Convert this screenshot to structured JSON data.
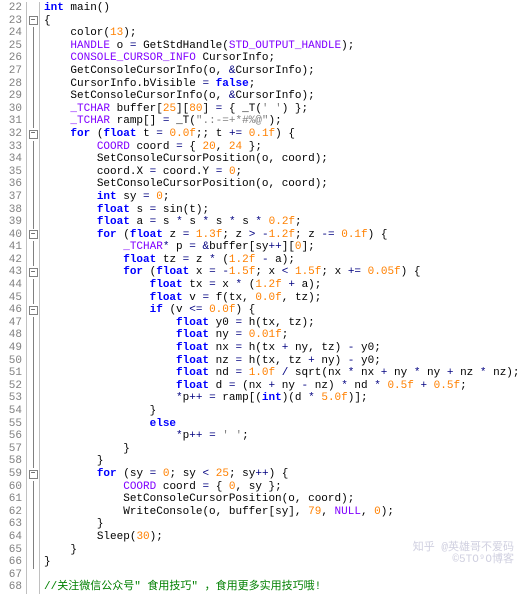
{
  "gutter_start": 22,
  "lines": [
    {
      "n": 22,
      "fold": "",
      "html": "<span class='kw'>int</span> <span class='fn'>main</span><span class='p'>()</span>"
    },
    {
      "n": 23,
      "fold": "box",
      "html": "<span class='p'>{</span>"
    },
    {
      "n": 24,
      "fold": "line",
      "html": "    <span class='fn'>color</span><span class='p'>(</span><span class='num'>13</span><span class='p'>);</span>"
    },
    {
      "n": 25,
      "fold": "line",
      "html": "    <span class='ty'>HANDLE</span> <span class='id'>o</span> <span class='op'>=</span> <span class='fn'>GetStdHandle</span><span class='p'>(</span><span class='mac'>STD_OUTPUT_HANDLE</span><span class='p'>);</span>"
    },
    {
      "n": 26,
      "fold": "line",
      "html": "    <span class='ty'>CONSOLE_CURSOR_INFO</span> <span class='id'>CursorInfo</span><span class='p'>;</span>"
    },
    {
      "n": 27,
      "fold": "line",
      "html": "    <span class='fn'>GetConsoleCursorInfo</span><span class='p'>(</span><span class='id'>o</span><span class='p'>,</span> <span class='op'>&amp;</span><span class='id'>CursorInfo</span><span class='p'>);</span>"
    },
    {
      "n": 28,
      "fold": "line",
      "html": "    <span class='id'>CursorInfo</span><span class='p'>.</span><span class='id'>bVisible</span> <span class='op'>=</span> <span class='kw'>false</span><span class='p'>;</span>"
    },
    {
      "n": 29,
      "fold": "line",
      "html": "    <span class='fn'>SetConsoleCursorInfo</span><span class='p'>(</span><span class='id'>o</span><span class='p'>,</span> <span class='op'>&amp;</span><span class='id'>CursorInfo</span><span class='p'>);</span>"
    },
    {
      "n": 30,
      "fold": "line",
      "html": "    <span class='ty'>_TCHAR</span> <span class='id'>buffer</span><span class='p'>[</span><span class='num'>25</span><span class='p'>][</span><span class='num'>80</span><span class='p'>]</span> <span class='op'>=</span> <span class='p'>{</span> <span class='fn'>_T</span><span class='p'>(</span><span class='str'>' '</span><span class='p'>) };</span>"
    },
    {
      "n": 31,
      "fold": "line",
      "html": "    <span class='ty'>_TCHAR</span> <span class='id'>ramp</span><span class='p'>[]</span> <span class='op'>=</span> <span class='fn'>_T</span><span class='p'>(</span><span class='str'>\".:-=+*#%@\"</span><span class='p'>);</span>"
    },
    {
      "n": 32,
      "fold": "box",
      "html": "    <span class='kw'>for</span> <span class='p'>(</span><span class='kw'>float</span> <span class='id'>t</span> <span class='op'>=</span> <span class='num'>0.0f</span><span class='p'>;;</span> <span class='id'>t</span> <span class='op'>+=</span> <span class='num'>0.1f</span><span class='p'>) {</span>"
    },
    {
      "n": 33,
      "fold": "line",
      "html": "        <span class='ty'>COORD</span> <span class='id'>coord</span> <span class='op'>=</span> <span class='p'>{</span> <span class='num'>20</span><span class='p'>,</span> <span class='num'>24</span> <span class='p'>};</span>"
    },
    {
      "n": 34,
      "fold": "line",
      "html": "        <span class='fn'>SetConsoleCursorPosition</span><span class='p'>(</span><span class='id'>o</span><span class='p'>,</span> <span class='id'>coord</span><span class='p'>);</span>"
    },
    {
      "n": 35,
      "fold": "line",
      "html": "        <span class='id'>coord</span><span class='p'>.</span><span class='id'>X</span> <span class='op'>=</span> <span class='id'>coord</span><span class='p'>.</span><span class='id'>Y</span> <span class='op'>=</span> <span class='num'>0</span><span class='p'>;</span>"
    },
    {
      "n": 36,
      "fold": "line",
      "html": "        <span class='fn'>SetConsoleCursorPosition</span><span class='p'>(</span><span class='id'>o</span><span class='p'>,</span> <span class='id'>coord</span><span class='p'>);</span>"
    },
    {
      "n": 37,
      "fold": "line",
      "html": "        <span class='kw'>int</span> <span class='id'>sy</span> <span class='op'>=</span> <span class='num'>0</span><span class='p'>;</span>"
    },
    {
      "n": 38,
      "fold": "line",
      "html": "        <span class='kw'>float</span> <span class='id'>s</span> <span class='op'>=</span> <span class='fn'>sin</span><span class='p'>(</span><span class='id'>t</span><span class='p'>);</span>"
    },
    {
      "n": 39,
      "fold": "line",
      "html": "        <span class='kw'>float</span> <span class='id'>a</span> <span class='op'>=</span> <span class='id'>s</span> <span class='op'>*</span> <span class='id'>s</span> <span class='op'>*</span> <span class='id'>s</span> <span class='op'>*</span> <span class='id'>s</span> <span class='op'>*</span> <span class='num'>0.2f</span><span class='p'>;</span>"
    },
    {
      "n": 40,
      "fold": "box",
      "html": "        <span class='kw'>for</span> <span class='p'>(</span><span class='kw'>float</span> <span class='id'>z</span> <span class='op'>=</span> <span class='num'>1.3f</span><span class='p'>;</span> <span class='id'>z</span> <span class='op'>&gt;</span> <span class='op'>-</span><span class='num'>1.2f</span><span class='p'>;</span> <span class='id'>z</span> <span class='op'>-=</span> <span class='num'>0.1f</span><span class='p'>) {</span>"
    },
    {
      "n": 41,
      "fold": "line",
      "html": "            <span class='ty'>_TCHAR</span><span class='op'>*</span> <span class='id'>p</span> <span class='op'>=</span> <span class='op'>&amp;</span><span class='id'>buffer</span><span class='p'>[</span><span class='id'>sy</span><span class='op'>++</span><span class='p'>][</span><span class='num'>0</span><span class='p'>];</span>"
    },
    {
      "n": 42,
      "fold": "line",
      "html": "            <span class='kw'>float</span> <span class='id'>tz</span> <span class='op'>=</span> <span class='id'>z</span> <span class='op'>*</span> <span class='p'>(</span><span class='num'>1.2f</span> <span class='op'>-</span> <span class='id'>a</span><span class='p'>);</span>"
    },
    {
      "n": 43,
      "fold": "box",
      "html": "            <span class='kw'>for</span> <span class='p'>(</span><span class='kw'>float</span> <span class='id'>x</span> <span class='op'>=</span> <span class='op'>-</span><span class='num'>1.5f</span><span class='p'>;</span> <span class='id'>x</span> <span class='op'>&lt;</span> <span class='num'>1.5f</span><span class='p'>;</span> <span class='id'>x</span> <span class='op'>+=</span> <span class='num'>0.05f</span><span class='p'>) {</span>"
    },
    {
      "n": 44,
      "fold": "line",
      "html": "                <span class='kw'>float</span> <span class='id'>tx</span> <span class='op'>=</span> <span class='id'>x</span> <span class='op'>*</span> <span class='p'>(</span><span class='num'>1.2f</span> <span class='op'>+</span> <span class='id'>a</span><span class='p'>);</span>"
    },
    {
      "n": 45,
      "fold": "line",
      "html": "                <span class='kw'>float</span> <span class='id'>v</span> <span class='op'>=</span> <span class='fn'>f</span><span class='p'>(</span><span class='id'>tx</span><span class='p'>,</span> <span class='num'>0.0f</span><span class='p'>,</span> <span class='id'>tz</span><span class='p'>);</span>"
    },
    {
      "n": 46,
      "fold": "box",
      "html": "                <span class='kw'>if</span> <span class='p'>(</span><span class='id'>v</span> <span class='op'>&lt;=</span> <span class='num'>0.0f</span><span class='p'>) {</span>"
    },
    {
      "n": 47,
      "fold": "line",
      "html": "                    <span class='kw'>float</span> <span class='id'>y0</span> <span class='op'>=</span> <span class='fn'>h</span><span class='p'>(</span><span class='id'>tx</span><span class='p'>,</span> <span class='id'>tz</span><span class='p'>);</span>"
    },
    {
      "n": 48,
      "fold": "line",
      "html": "                    <span class='kw'>float</span> <span class='id'>ny</span> <span class='op'>=</span> <span class='num'>0.01f</span><span class='p'>;</span>"
    },
    {
      "n": 49,
      "fold": "line",
      "html": "                    <span class='kw'>float</span> <span class='id'>nx</span> <span class='op'>=</span> <span class='fn'>h</span><span class='p'>(</span><span class='id'>tx</span> <span class='op'>+</span> <span class='id'>ny</span><span class='p'>,</span> <span class='id'>tz</span><span class='p'>)</span> <span class='op'>-</span> <span class='id'>y0</span><span class='p'>;</span>"
    },
    {
      "n": 50,
      "fold": "line",
      "html": "                    <span class='kw'>float</span> <span class='id'>nz</span> <span class='op'>=</span> <span class='fn'>h</span><span class='p'>(</span><span class='id'>tx</span><span class='p'>,</span> <span class='id'>tz</span> <span class='op'>+</span> <span class='id'>ny</span><span class='p'>)</span> <span class='op'>-</span> <span class='id'>y0</span><span class='p'>;</span>"
    },
    {
      "n": 51,
      "fold": "line",
      "html": "                    <span class='kw'>float</span> <span class='id'>nd</span> <span class='op'>=</span> <span class='num'>1.0f</span> <span class='op'>/</span> <span class='fn'>sqrt</span><span class='p'>(</span><span class='id'>nx</span> <span class='op'>*</span> <span class='id'>nx</span> <span class='op'>+</span> <span class='id'>ny</span> <span class='op'>*</span> <span class='id'>ny</span> <span class='op'>+</span> <span class='id'>nz</span> <span class='op'>*</span> <span class='id'>nz</span><span class='p'>);</span>"
    },
    {
      "n": 52,
      "fold": "line",
      "html": "                    <span class='kw'>float</span> <span class='id'>d</span> <span class='op'>=</span> <span class='p'>(</span><span class='id'>nx</span> <span class='op'>+</span> <span class='id'>ny</span> <span class='op'>-</span> <span class='id'>nz</span><span class='p'>)</span> <span class='op'>*</span> <span class='id'>nd</span> <span class='op'>*</span> <span class='num'>0.5f</span> <span class='op'>+</span> <span class='num'>0.5f</span><span class='p'>;</span>"
    },
    {
      "n": 53,
      "fold": "line",
      "html": "                    <span class='op'>*</span><span class='id'>p</span><span class='op'>++</span> <span class='op'>=</span> <span class='id'>ramp</span><span class='p'>[(</span><span class='kw'>int</span><span class='p'>)(</span><span class='id'>d</span> <span class='op'>*</span> <span class='num'>5.0f</span><span class='p'>)];</span>"
    },
    {
      "n": 54,
      "fold": "line",
      "html": "                <span class='p'>}</span>"
    },
    {
      "n": 55,
      "fold": "line",
      "html": "                <span class='kw'>else</span>"
    },
    {
      "n": 56,
      "fold": "line",
      "html": "                    <span class='op'>*</span><span class='id'>p</span><span class='op'>++</span> <span class='op'>=</span> <span class='str'>' '</span><span class='p'>;</span>"
    },
    {
      "n": 57,
      "fold": "line",
      "html": "            <span class='p'>}</span>"
    },
    {
      "n": 58,
      "fold": "line",
      "html": "        <span class='p'>}</span>"
    },
    {
      "n": 59,
      "fold": "box",
      "html": "        <span class='kw'>for</span> <span class='p'>(</span><span class='id'>sy</span> <span class='op'>=</span> <span class='num'>0</span><span class='p'>;</span> <span class='id'>sy</span> <span class='op'>&lt;</span> <span class='num'>25</span><span class='p'>;</span> <span class='id'>sy</span><span class='op'>++</span><span class='p'>) {</span>"
    },
    {
      "n": 60,
      "fold": "line",
      "html": "            <span class='ty'>COORD</span> <span class='id'>coord</span> <span class='op'>=</span> <span class='p'>{</span> <span class='num'>0</span><span class='p'>,</span> <span class='id'>sy</span> <span class='p'>};</span>"
    },
    {
      "n": 61,
      "fold": "line",
      "html": "            <span class='fn'>SetConsoleCursorPosition</span><span class='p'>(</span><span class='id'>o</span><span class='p'>,</span> <span class='id'>coord</span><span class='p'>);</span>"
    },
    {
      "n": 62,
      "fold": "line",
      "html": "            <span class='fn'>WriteConsole</span><span class='p'>(</span><span class='id'>o</span><span class='p'>,</span> <span class='id'>buffer</span><span class='p'>[</span><span class='id'>sy</span><span class='p'>],</span> <span class='num'>79</span><span class='p'>,</span> <span class='mac'>NULL</span><span class='p'>,</span> <span class='num'>0</span><span class='p'>);</span>"
    },
    {
      "n": 63,
      "fold": "line",
      "html": "        <span class='p'>}</span>"
    },
    {
      "n": 64,
      "fold": "line",
      "html": "        <span class='fn'>Sleep</span><span class='p'>(</span><span class='num'>30</span><span class='p'>);</span>"
    },
    {
      "n": 65,
      "fold": "line",
      "html": "    <span class='p'>}</span>"
    },
    {
      "n": 66,
      "fold": "line",
      "html": "<span class='p'>}</span>"
    },
    {
      "n": 67,
      "fold": "",
      "html": ""
    },
    {
      "n": 68,
      "fold": "",
      "html": "<span class='cm'>//关注微信公众号\" 食用技巧\" ，食用更多实用技巧哦!</span>"
    }
  ],
  "watermark": {
    "line1": "知乎 @英雄哥不爱码",
    "line2": "©5TO⁹O博客"
  }
}
